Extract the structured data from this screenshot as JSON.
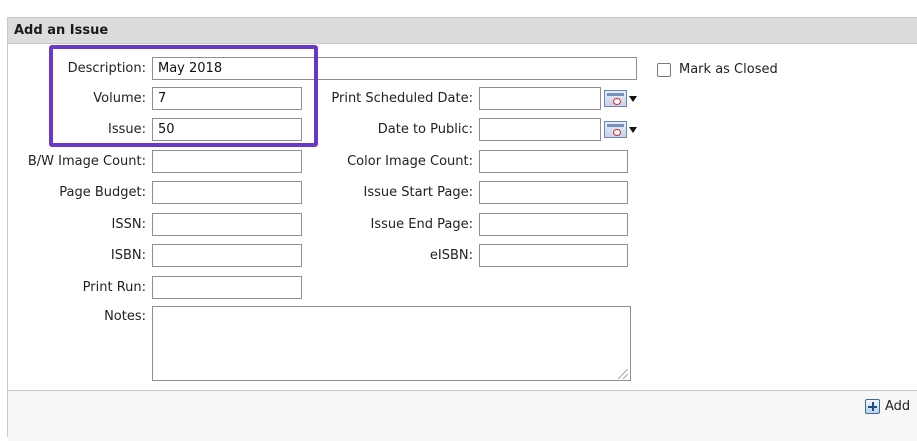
{
  "panel": {
    "title": "Add an Issue"
  },
  "fields": {
    "description": {
      "label": "Description:",
      "value": "May 2018"
    },
    "volume": {
      "label": "Volume:",
      "value": "7"
    },
    "issue": {
      "label": "Issue:",
      "value": "50"
    },
    "bw_image_count": {
      "label": "B/W Image Count:",
      "value": ""
    },
    "page_budget": {
      "label": "Page Budget:",
      "value": ""
    },
    "issn": {
      "label": "ISSN:",
      "value": ""
    },
    "isbn": {
      "label": "ISBN:",
      "value": ""
    },
    "print_run": {
      "label": "Print Run:",
      "value": ""
    },
    "notes": {
      "label": "Notes:",
      "value": ""
    },
    "print_scheduled_date": {
      "label": "Print Scheduled Date:",
      "value": ""
    },
    "date_to_public": {
      "label": "Date to Public:",
      "value": ""
    },
    "color_image_count": {
      "label": "Color Image Count:",
      "value": ""
    },
    "issue_start_page": {
      "label": "Issue Start Page:",
      "value": ""
    },
    "issue_end_page": {
      "label": "Issue End Page:",
      "value": ""
    },
    "eisbn": {
      "label": "eISBN:",
      "value": ""
    }
  },
  "mark_closed": {
    "label": "Mark as Closed",
    "checked": false
  },
  "actions": {
    "add_label": "Add"
  },
  "colors": {
    "header_bg": "#dcdcdc",
    "highlight_border": "#6a37c9",
    "border": "#c9c9c9"
  }
}
